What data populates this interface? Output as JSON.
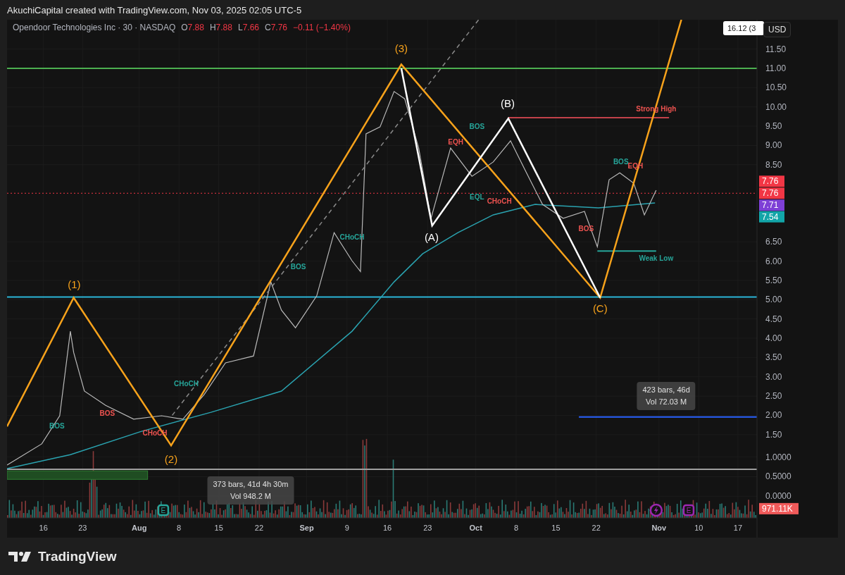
{
  "header": {
    "credit": "AkuchiCapital created with TradingView.com, Nov 03, 2025 02:05 UTC-5"
  },
  "legend": {
    "title": "Opendoor Technologies Inc · 30 · NASDAQ",
    "ohlc": [
      {
        "label": "O",
        "value": "7.88"
      },
      {
        "label": "H",
        "value": "7.88"
      },
      {
        "label": "L",
        "value": "7.66"
      },
      {
        "label": "C",
        "value": "7.76"
      }
    ],
    "change": "−0.11 (−1.40%)"
  },
  "axis": {
    "currency": "USD"
  },
  "chart": {
    "price_axis": [
      "11.50",
      "11.00",
      "10.50",
      "10.00",
      "9.50",
      "9.00",
      "8.50",
      "6.50",
      "6.00",
      "5.50",
      "5.00",
      "4.50",
      "4.00",
      "3.50",
      "3.00",
      "2.50",
      "2.00",
      "1.50",
      "1.0000",
      "0.5000",
      "0.0000"
    ],
    "time_axis": [
      {
        "label": "16",
        "kind": "day"
      },
      {
        "label": "23",
        "kind": "day"
      },
      {
        "label": "Aug",
        "kind": "month"
      },
      {
        "label": "8",
        "kind": "day"
      },
      {
        "label": "15",
        "kind": "day"
      },
      {
        "label": "22",
        "kind": "day"
      },
      {
        "label": "Sep",
        "kind": "month"
      },
      {
        "label": "9",
        "kind": "day"
      },
      {
        "label": "16",
        "kind": "day"
      },
      {
        "label": "23",
        "kind": "day"
      },
      {
        "label": "Oct",
        "kind": "month"
      },
      {
        "label": "8",
        "kind": "day"
      },
      {
        "label": "15",
        "kind": "day"
      },
      {
        "label": "22",
        "kind": "day"
      },
      {
        "label": "Nov",
        "kind": "month"
      },
      {
        "label": "10",
        "kind": "day"
      },
      {
        "label": "17",
        "kind": "day"
      }
    ],
    "top_tag": "16.12 (3",
    "price_tags": [
      {
        "text": "7.76",
        "color": "#f23645"
      },
      {
        "text": "7.76",
        "color": "#f23645"
      },
      {
        "text": "7.71",
        "color": "#7e3fd6"
      },
      {
        "text": "7.54",
        "color": "#12a5a8"
      }
    ],
    "volume_tag": {
      "text": "971.11K",
      "color": "#f05a5a"
    },
    "wave_labels": [
      {
        "text": "(1)",
        "color": "#f7a21b"
      },
      {
        "text": "(2)",
        "color": "#f7a21b"
      },
      {
        "text": "(3)",
        "color": "#f7a21b"
      },
      {
        "text": "(A)",
        "color": "#ffffff"
      },
      {
        "text": "(B)",
        "color": "#ffffff"
      },
      {
        "text": "(C)",
        "color": "#f7a21b"
      }
    ],
    "structure_labels": [
      {
        "text": "BOS",
        "color": "#26a69a"
      },
      {
        "text": "BOS",
        "color": "#ef5350"
      },
      {
        "text": "CHoCH",
        "color": "#ef5350"
      },
      {
        "text": "CHoCH",
        "color": "#26a69a"
      },
      {
        "text": "BOS",
        "color": "#26a69a"
      },
      {
        "text": "CHoCH",
        "color": "#26a69a"
      },
      {
        "text": "EQH",
        "color": "#ef5350"
      },
      {
        "text": "BOS",
        "color": "#26a69a"
      },
      {
        "text": "EQL",
        "color": "#26a69a"
      },
      {
        "text": "CHoCH",
        "color": "#ef5350"
      },
      {
        "text": "BOS",
        "color": "#ef5350"
      },
      {
        "text": "BOS",
        "color": "#26a69a"
      },
      {
        "text": "EQH",
        "color": "#ef5350"
      },
      {
        "text": "Strong High",
        "color": "#ef5350"
      },
      {
        "text": "Weak Low",
        "color": "#26a69a"
      }
    ],
    "measurements": [
      {
        "lines": [
          "423 bars, 46d",
          "Vol 72.03 M"
        ]
      },
      {
        "lines": [
          "373 bars, 41d 4h 30m",
          "Vol 948.2 M"
        ]
      }
    ],
    "events": [
      {
        "kind": "earnings",
        "text": "E",
        "color": "#26a69a"
      },
      {
        "kind": "split",
        "color": "#9c27b0"
      },
      {
        "kind": "earnings",
        "text": "E",
        "color": "#9c27b0"
      }
    ]
  },
  "footer": {
    "brand": "TradingView"
  }
}
